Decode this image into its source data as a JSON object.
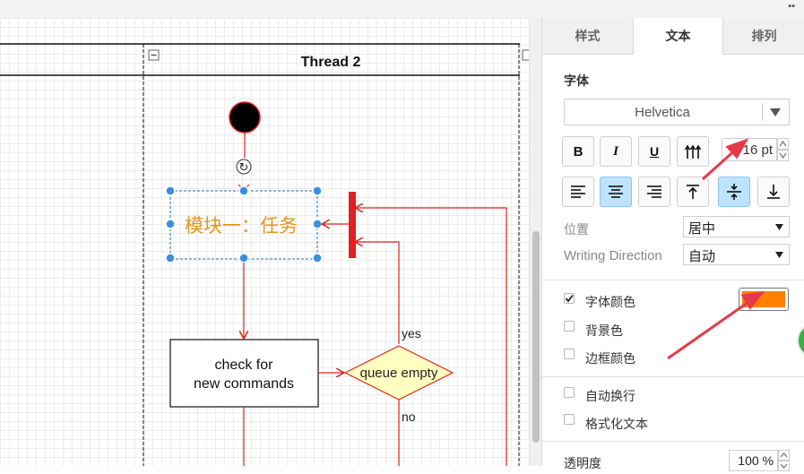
{
  "window": {
    "controls": "▪▪"
  },
  "canvas": {
    "lane_title": "Thread 2",
    "collapse_glyph": "−",
    "task_label": "模块一：任务",
    "check_box_line1": "check for",
    "check_box_line2": "new commands",
    "decision_label": "queue empty",
    "yes_label": "yes",
    "no_label": "no",
    "rotate_glyph": "↻"
  },
  "panel": {
    "tabs": [
      {
        "label": "样式",
        "active": false
      },
      {
        "label": "文本",
        "active": true
      },
      {
        "label": "排列",
        "active": false
      }
    ],
    "font_section_label": "字体",
    "font_family": "Helvetica",
    "font_size": "16 pt",
    "style_buttons": {
      "bold": "B",
      "italic": "I",
      "underline": "U"
    },
    "position_label": "位置",
    "position_value": "居中",
    "writing_direction_label": "Writing Direction",
    "writing_direction_value": "自动",
    "font_color_label": "字体颜色",
    "font_color_checked": true,
    "font_color_value": "#ff8000",
    "background_color_label": "背景色",
    "border_color_label": "边框颜色",
    "word_wrap_label": "自动换行",
    "formatted_text_label": "格式化文本",
    "opacity_label": "透明度",
    "opacity_value": "100 %"
  },
  "colors": {
    "accent_red": "#e02020",
    "selection_blue": "#3b8fe0",
    "task_text": "#e8941a",
    "decision_fill": "#ffffc0",
    "annotation_arrow": "#e8394a"
  }
}
